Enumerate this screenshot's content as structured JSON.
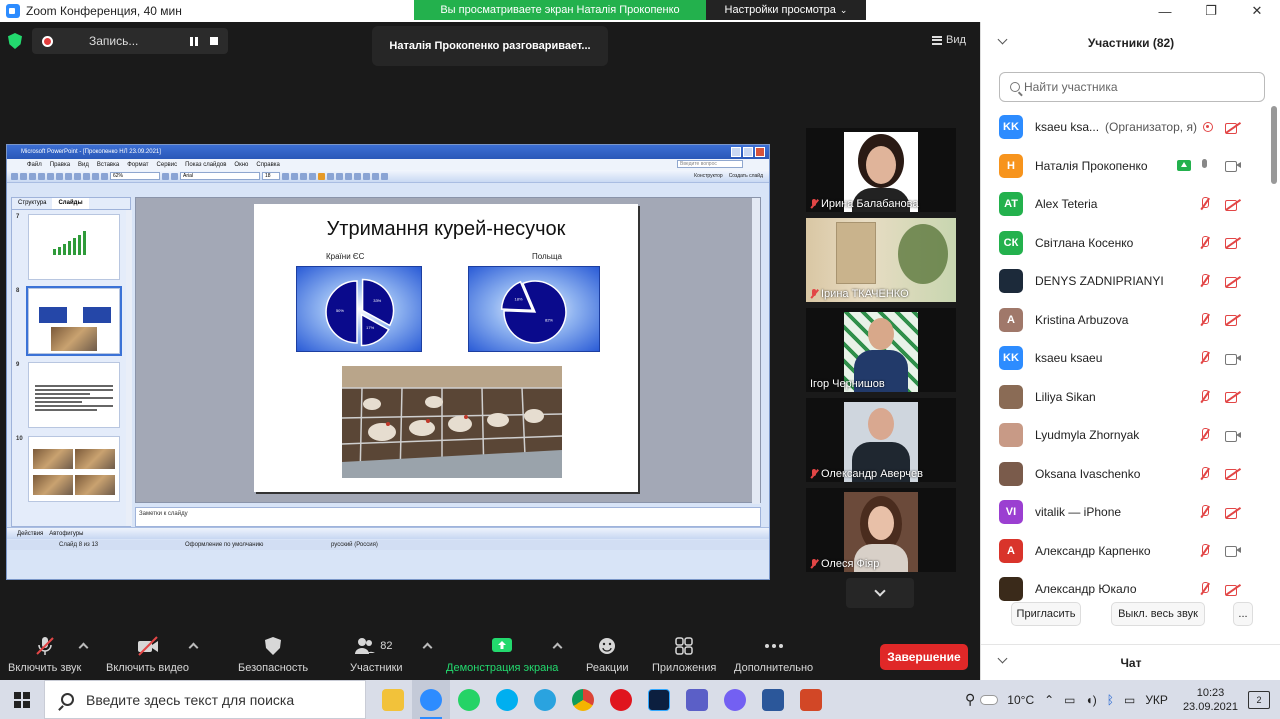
{
  "window": {
    "title": "Zoom Конференция, 40 мин",
    "share_banner": "Вы просматриваете экран Наталія Прокопенко",
    "view_options": "Настройки просмотра"
  },
  "meeting": {
    "recording_label": "Запись...",
    "speaker_toast": "Наталія Прокопенко разговаривает...",
    "view_label": "Вид"
  },
  "ppt": {
    "title": "Microsoft PowerPoint - [Прокопенко НЛ 23.09.2021]",
    "menu": [
      "Файл",
      "Правка",
      "Вид",
      "Вставка",
      "Формат",
      "Сервис",
      "Показ слайдов",
      "Окно",
      "Справка"
    ],
    "help_placeholder": "Введите вопрос",
    "zoom": "62%",
    "font": "Arial",
    "font_size": "18",
    "toolbar_right": [
      "Конструктор",
      "Создать слайд"
    ],
    "tabs": [
      "Структура",
      "Слайды"
    ],
    "slide_numbers": [
      "7",
      "8",
      "9",
      "10"
    ],
    "notes_placeholder": "Заметки к слайду",
    "draw_toolbar": [
      "Действия",
      "Автофигуры"
    ],
    "status": {
      "slide": "Слайд 8 из 13",
      "design": "Оформление по умолчанию",
      "language": "русский (Россия)"
    },
    "slide": {
      "title": "Утримання курей-несучок",
      "chart_left_label": "Країни ЄС",
      "chart_right_label": "Польща"
    }
  },
  "chart_data": [
    {
      "type": "pie",
      "title": "Країни ЄС",
      "slices": [
        {
          "label": "",
          "value": 33
        },
        {
          "label": "",
          "value": 17
        },
        {
          "label": "",
          "value": 50
        }
      ]
    },
    {
      "type": "pie",
      "title": "Польща",
      "slices": [
        {
          "label": "",
          "value": 82
        },
        {
          "label": "",
          "value": 18
        }
      ]
    }
  ],
  "videos": [
    {
      "name": "Ирина Балабанова"
    },
    {
      "name": "Ірина ТКАЧЕНКО"
    },
    {
      "name": "Ігор Чернишов"
    },
    {
      "name": "Олександр Аверчев"
    },
    {
      "name": "Олеся Фіяр"
    }
  ],
  "controls": {
    "audio": "Включить звук",
    "video": "Включить видео",
    "security": "Безопасность",
    "participants": "Участники",
    "participants_count": "82",
    "share": "Демонстрация экрана",
    "reactions": "Реакции",
    "apps": "Приложения",
    "more": "Дополнительно",
    "end": "Завершение"
  },
  "panel": {
    "title": "Участники (82)",
    "search_placeholder": "Найти участника",
    "invite": "Пригласить",
    "mute_all": "Выкл. весь звук",
    "more": "...",
    "chat": "Чат",
    "participants": [
      {
        "initials": "KK",
        "color": "#2d8cff",
        "name": "ksaeu ksa...",
        "role": "(Организатор, я)",
        "mic": "rec",
        "cam": "off"
      },
      {
        "initials": "Н",
        "color": "#f7941d",
        "name": "Наталія Прокопенко",
        "role": "",
        "mic": "on",
        "cam": "on",
        "sharing": true
      },
      {
        "initials": "AT",
        "color": "#23b14d",
        "name": "Alex Teteria",
        "role": "",
        "mic": "off",
        "cam": "off"
      },
      {
        "initials": "СК",
        "color": "#23b14d",
        "name": "Світлана Косенко",
        "role": "",
        "mic": "off",
        "cam": "off"
      },
      {
        "initials": "",
        "color": "#1c2a3a",
        "name": "DENYS ZADNIPRIANYI",
        "role": "",
        "mic": "off",
        "cam": "off"
      },
      {
        "initials": "A",
        "color": "#a0786a",
        "name": "Kristina Arbuzova",
        "role": "",
        "mic": "off",
        "cam": "off"
      },
      {
        "initials": "KK",
        "color": "#2d8cff",
        "name": "ksaeu ksaeu",
        "role": "",
        "mic": "off",
        "cam": "on"
      },
      {
        "initials": "",
        "color": "#8a6b55",
        "name": "Liliya Sikan",
        "role": "",
        "mic": "off",
        "cam": "off"
      },
      {
        "initials": "",
        "color": "#c89a86",
        "name": "Lyudmyla Zhornyak",
        "role": "",
        "mic": "off",
        "cam": "on"
      },
      {
        "initials": "",
        "color": "#7a5b4b",
        "name": "Oksana Ivaschenko",
        "role": "",
        "mic": "off",
        "cam": "off"
      },
      {
        "initials": "VI",
        "color": "#9b3fd1",
        "name": "vitalik — iPhone",
        "role": "",
        "mic": "off",
        "cam": "off"
      },
      {
        "initials": "А",
        "color": "#d9342b",
        "name": "Александр Карпенко",
        "role": "",
        "mic": "off",
        "cam": "on"
      },
      {
        "initials": "",
        "color": "#3a2a1a",
        "name": "Александр Юкало",
        "role": "",
        "mic": "off",
        "cam": "off"
      }
    ]
  },
  "taskbar": {
    "search_placeholder": "Введите здесь текст для поиска",
    "weather": "10°C",
    "lang": "УКР",
    "time": "10:23",
    "date": "23.09.2021",
    "notifications": "2"
  }
}
